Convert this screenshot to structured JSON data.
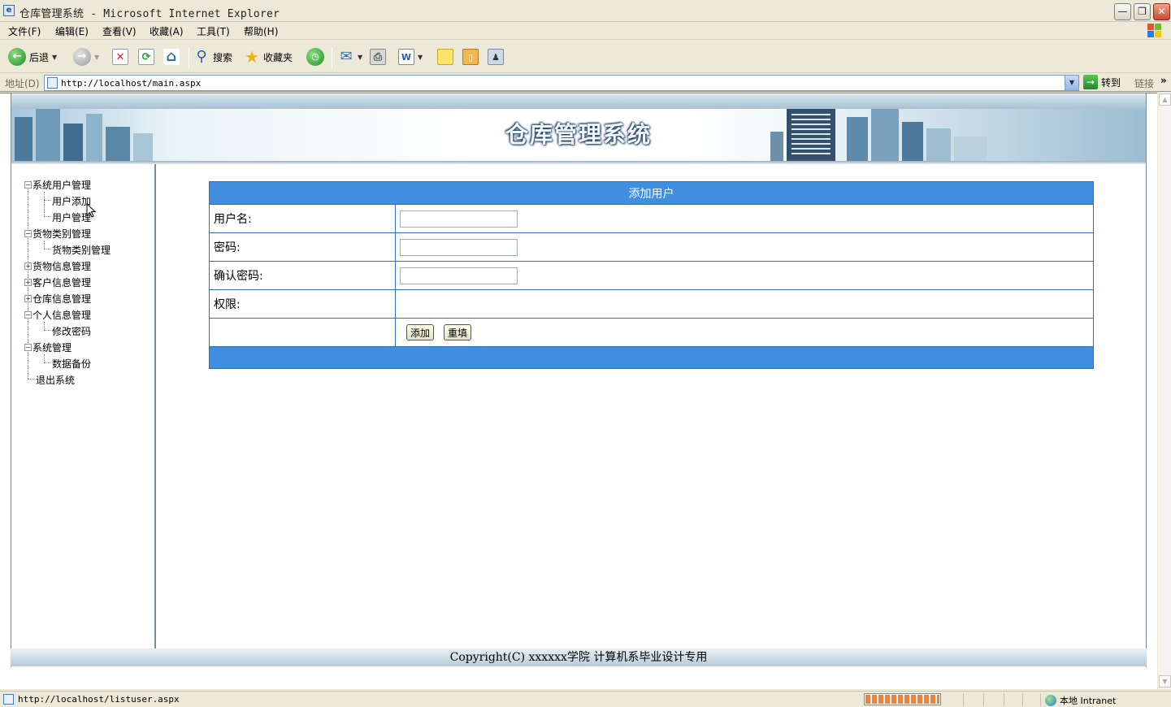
{
  "window": {
    "title": "仓库管理系统 - Microsoft Internet Explorer",
    "min_symbol": "—",
    "max_symbol": "❐",
    "close_symbol": "✕"
  },
  "menu": [
    "文件(F)",
    "编辑(E)",
    "查看(V)",
    "收藏(A)",
    "工具(T)",
    "帮助(H)"
  ],
  "toolbar": {
    "back_label": "后退",
    "search_label": "搜索",
    "favorites_label": "收藏夹"
  },
  "address": {
    "label": "地址(D)",
    "url": "http://localhost/main.aspx",
    "go_label": "转到",
    "links_label": "链接"
  },
  "banner": {
    "title": "仓库管理系统"
  },
  "sidebar": {
    "items": [
      {
        "label": "系统用户管理",
        "toggle": "−"
      },
      {
        "label": "用户添加"
      },
      {
        "label": "用户管理"
      },
      {
        "label": "货物类别管理",
        "toggle": "−"
      },
      {
        "label": "货物类别管理"
      },
      {
        "label": "货物信息管理",
        "toggle": "+"
      },
      {
        "label": "客户信息管理",
        "toggle": "+"
      },
      {
        "label": "仓库信息管理",
        "toggle": "+"
      },
      {
        "label": "个人信息管理",
        "toggle": "−"
      },
      {
        "label": "修改密码"
      },
      {
        "label": "系统管理",
        "toggle": "−"
      },
      {
        "label": "数据备份"
      },
      {
        "label": "退出系统"
      }
    ]
  },
  "form": {
    "title": "添加用户",
    "username_label": "用户名:",
    "username_value": "",
    "password_label": "密码:",
    "password_value": "",
    "confirm_label": "确认密码:",
    "confirm_value": "",
    "permission_label": "权限:",
    "add_button": "添加",
    "reset_button": "重填"
  },
  "footer": {
    "text": "Copyright(C) xxxxxx学院 计算机系毕业设计专用"
  },
  "status": {
    "url": "http://localhost/listuser.aspx",
    "progress_fraction": 1.0,
    "zone": "本地 Intranet"
  }
}
